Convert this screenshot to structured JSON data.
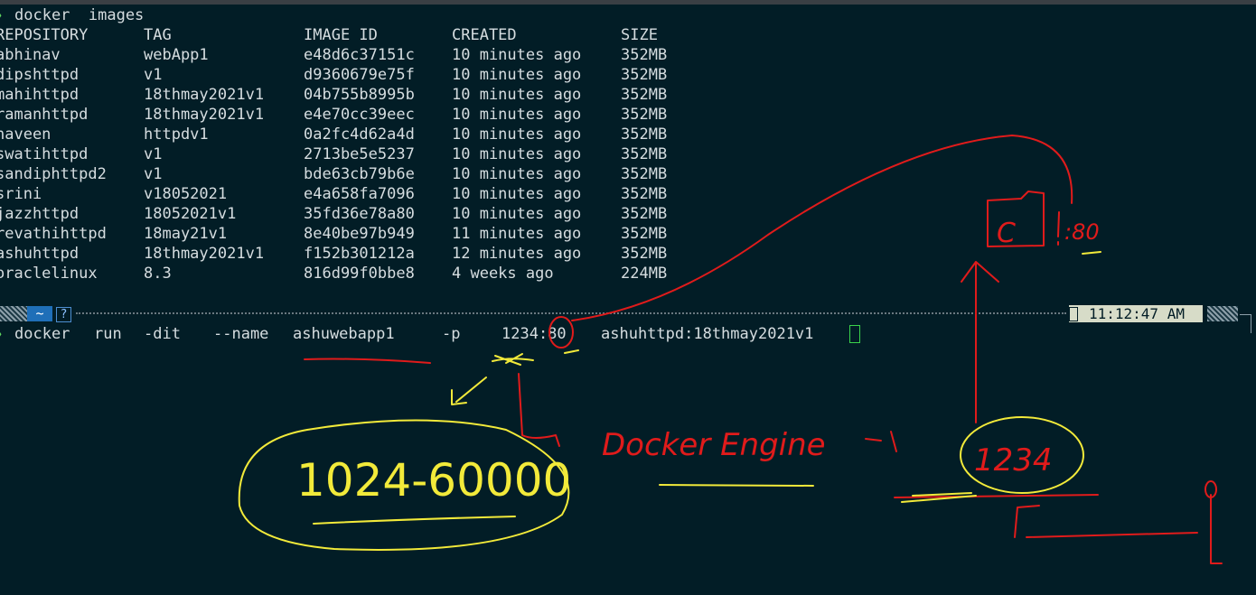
{
  "terminal": {
    "cmd_images": "docker  images",
    "headers": [
      "REPOSITORY",
      "TAG",
      "IMAGE ID",
      "CREATED",
      "SIZE"
    ],
    "rows": [
      [
        "abhinav",
        "webApp1",
        "e48d6c37151c",
        "10 minutes ago",
        "352MB"
      ],
      [
        "dipshttpd",
        "v1",
        "d9360679e75f",
        "10 minutes ago",
        "352MB"
      ],
      [
        "mahihttpd",
        "18thmay2021v1",
        "04b755b8995b",
        "10 minutes ago",
        "352MB"
      ],
      [
        "ramanhttpd",
        "18thmay2021v1",
        "e4e70cc39eec",
        "10 minutes ago",
        "352MB"
      ],
      [
        "naveen",
        "httpdv1",
        "0a2fc4d62a4d",
        "10 minutes ago",
        "352MB"
      ],
      [
        "swatihttpd",
        "v1",
        "2713be5e5237",
        "10 minutes ago",
        "352MB"
      ],
      [
        "sandiphttpd2",
        "v1",
        "bde63cb79b6e",
        "10 minutes ago",
        "352MB"
      ],
      [
        "srini",
        "v18052021",
        "e4a658fa7096",
        "10 minutes ago",
        "352MB"
      ],
      [
        "jazzhttpd",
        "18052021v1",
        "35fd36e78a80",
        "10 minutes ago",
        "352MB"
      ],
      [
        "revathihttpd",
        "18may21v1",
        "8e40be97b949",
        "11 minutes ago",
        "352MB"
      ],
      [
        "ashuhttpd",
        "18thmay2021v1",
        "f152b301212a",
        "12 minutes ago",
        "352MB"
      ],
      [
        "oraclelinux",
        "8.3",
        "816d99f0bbe8",
        "4 weeks ago",
        "224MB"
      ]
    ],
    "run_command": {
      "docker": "docker",
      "run": "run",
      "dit": "-dit",
      "name_flag": "--name",
      "name_value": "ashuwebapp1",
      "port_flag": "-p",
      "port_map": "1234:80",
      "image": "ashuhttpd:18thmay2021v1"
    }
  },
  "statusbar": {
    "home_glyph": "~",
    "help_glyph": "?",
    "time": "11:12:47 AM"
  },
  "annotations": {
    "range_note": "1024-60000",
    "engine_note": "Docker Engine",
    "host_port_note": "1234",
    "container_port_note": ":80",
    "container_label": "C"
  },
  "colors": {
    "background": "#021d26",
    "text": "#d6dde0",
    "prompt": "#5fd75f",
    "cursor": "#3ad34b",
    "ink_red": "#e01b1b",
    "ink_yellow": "#f2ea3a"
  }
}
